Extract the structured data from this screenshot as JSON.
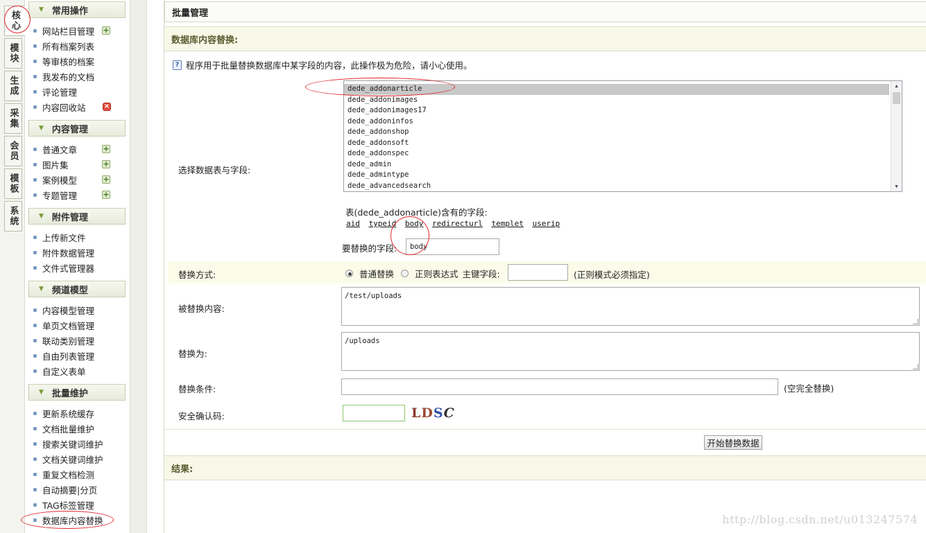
{
  "vertical_tabs": [
    "核心",
    "模块",
    "生成",
    "采集",
    "会员",
    "模板",
    "系统"
  ],
  "menu": {
    "groups": [
      {
        "title": "常用操作",
        "items": [
          "网站栏目管理",
          "所有档案列表",
          "等审核的档案",
          "我发布的文档",
          "评论管理",
          "内容回收站"
        ]
      },
      {
        "title": "内容管理",
        "items": [
          "普通文章",
          "图片集",
          "案例模型",
          "专题管理"
        ]
      },
      {
        "title": "附件管理",
        "items": [
          "上传新文件",
          "附件数据管理",
          "文件式管理器"
        ]
      },
      {
        "title": "频道模型",
        "items": [
          "内容模型管理",
          "单页文档管理",
          "联动类别管理",
          "自由列表管理",
          "自定义表单"
        ]
      },
      {
        "title": "批量维护",
        "items": [
          "更新系统缓存",
          "文档批量维护",
          "搜索关键词维护",
          "文档关键词维护",
          "重复文档检测",
          "自动摘要|分页",
          "TAG标签管理",
          "数据库内容替换"
        ]
      }
    ]
  },
  "main": {
    "title": "批量管理",
    "section_title": "数据库内容替换:",
    "info": "程序用于批量替换数据库中某字段的内容，此操作极为危险，请小心使用。",
    "select_label": "选择数据表与字段:",
    "tables": [
      "dede_addonarticle",
      "dede_addonimages",
      "dede_addonimages17",
      "dede_addoninfos",
      "dede_addonshop",
      "dede_addonsoft",
      "dede_addonspec",
      "dede_admin",
      "dede_admintype",
      "dede_advancedsearch"
    ],
    "selected_table": "dede_addonarticle",
    "fields_caption": "表(dede_addonarticle)含有的字段:",
    "fields": [
      "aid",
      "typeid",
      "body",
      "redirecturl",
      "templet",
      "userip"
    ],
    "replace_field_label": "要替换的字段:",
    "replace_field_value": "body",
    "mode_label": "替换方式:",
    "mode_normal": "普通替换",
    "mode_regex": "正则表达式",
    "primary_key_label": "主键字段:",
    "primary_key_value": "",
    "regex_note": "(正则模式必须指定)",
    "source_label": "被替换内容:",
    "source_value": "/test/uploads",
    "target_label": "替换为:",
    "target_value": "/uploads",
    "condition_label": "替换条件:",
    "condition_value": "",
    "condition_note": "(空完全替换)",
    "captcha_label": "安全确认码:",
    "captcha_value": "",
    "captcha_text": [
      "L",
      "D",
      "S",
      "C"
    ],
    "submit_label": "开始替换数据",
    "result_label": "结果:"
  },
  "watermark": "http://blog.csdn.net/u013247574",
  "colors": {
    "annotation": "#e0262c",
    "section_bg": "#f8f8e9",
    "menu_dot": "#6b8fb6"
  }
}
